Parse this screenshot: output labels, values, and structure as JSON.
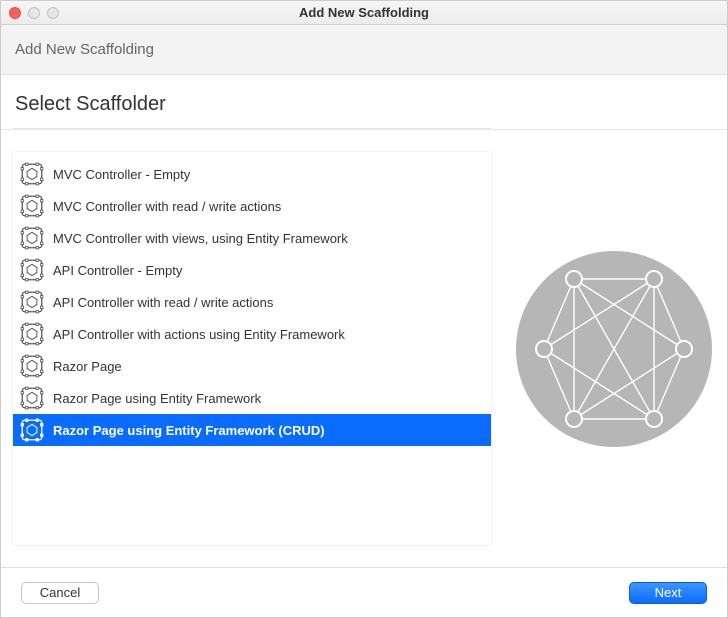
{
  "window": {
    "title": "Add New Scaffolding"
  },
  "subheader": "Add New Scaffolding",
  "section_title": "Select Scaffolder",
  "scaffolders": [
    {
      "label": "MVC Controller - Empty",
      "selected": false
    },
    {
      "label": "MVC Controller with read / write actions",
      "selected": false
    },
    {
      "label": "MVC Controller with views, using Entity Framework",
      "selected": false
    },
    {
      "label": "API Controller - Empty",
      "selected": false
    },
    {
      "label": "API Controller with read / write actions",
      "selected": false
    },
    {
      "label": "API Controller with actions using Entity Framework",
      "selected": false
    },
    {
      "label": "Razor Page",
      "selected": false
    },
    {
      "label": "Razor Page using Entity Framework",
      "selected": false
    },
    {
      "label": "Razor Page using Entity Framework (CRUD)",
      "selected": true
    }
  ],
  "buttons": {
    "cancel": "Cancel",
    "next": "Next"
  }
}
